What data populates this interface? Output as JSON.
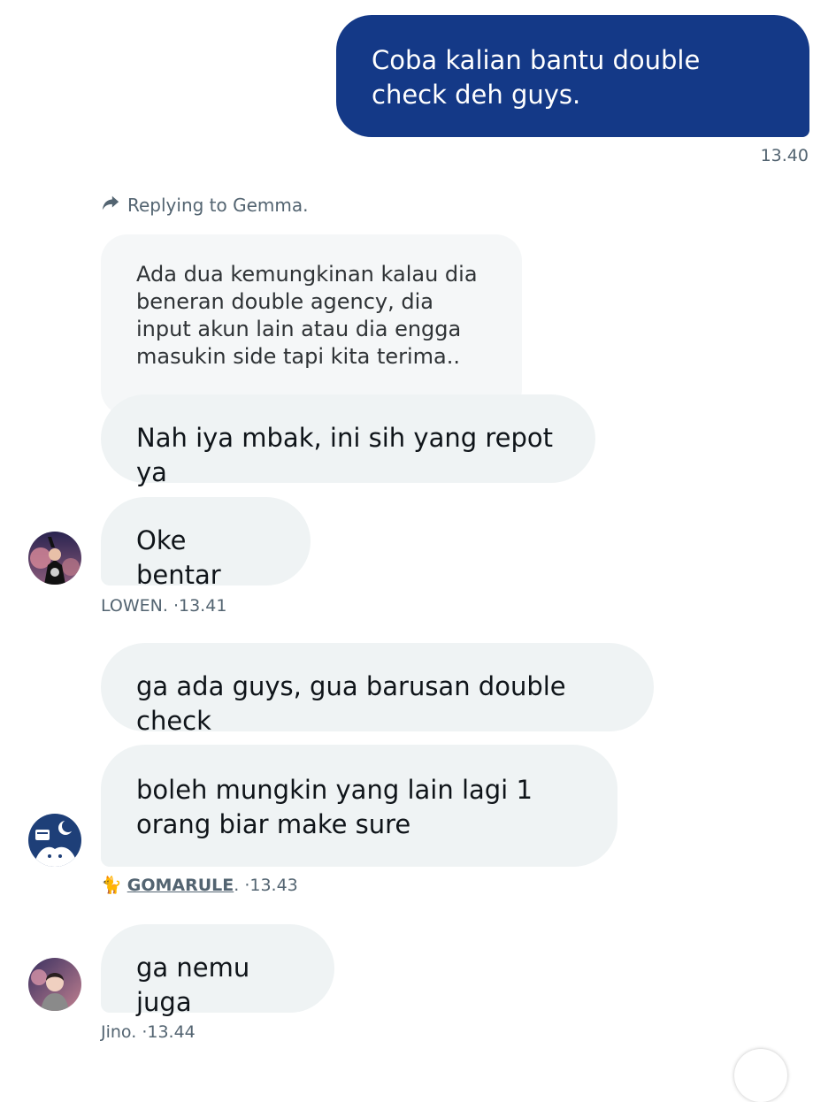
{
  "messages": {
    "sent": {
      "text": "Coba kalian bantu double check deh guys.",
      "time": "13.40"
    },
    "reply_context": "Replying to Gemma.",
    "quoted": {
      "text": "Ada dua kemungkinan kalau dia beneran double agency, dia input akun lain atau dia engga masukin side tapi kita terima.."
    },
    "lowen": {
      "msg1": "Nah iya mbak, ini sih yang repot ya",
      "msg2": "Oke bentar",
      "name": "LOWEN.",
      "time": "·13.41"
    },
    "gomarule": {
      "msg1": "ga ada guys, gua barusan double check",
      "msg2": "boleh mungkin yang lain lagi 1 orang biar make sure",
      "emoji": "🐈",
      "name": "GOMARULE",
      "suffix": ".",
      "time": "·13.43"
    },
    "jino": {
      "msg1": "ga nemu juga",
      "name": "Jino.",
      "time": "·13.44"
    }
  }
}
